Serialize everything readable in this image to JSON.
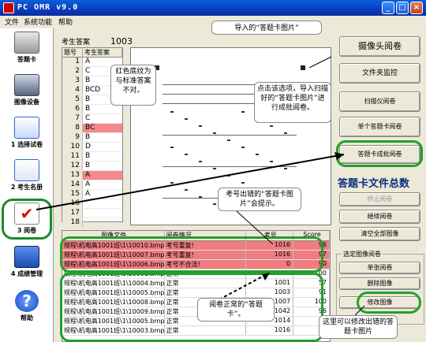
{
  "window": {
    "title": "PC OMR v9.0",
    "min": "_",
    "max": "□",
    "close": "×"
  },
  "menu": [
    "文件",
    "系统功能",
    "帮助"
  ],
  "sidebar": [
    {
      "label": "答题卡",
      "icon": "answer-card-icon"
    },
    {
      "label": "图像设备",
      "icon": "scanner-icon"
    },
    {
      "label": "1 选择试卷",
      "icon": "exam-select-icon"
    },
    {
      "label": "2 考生名册",
      "icon": "roster-icon"
    },
    {
      "label": "3 阅卷",
      "icon": "grading-check-icon"
    },
    {
      "label": "4 成绩管理",
      "icon": "score-management-icon"
    },
    {
      "label": "帮助",
      "icon": "help-icon"
    }
  ],
  "answers": {
    "label": "考生答案",
    "number": "1003",
    "headers": [
      "题号",
      "考生答案"
    ],
    "rows": [
      {
        "n": "1",
        "a": "A",
        "bad": false
      },
      {
        "n": "2",
        "a": "C",
        "bad": false
      },
      {
        "n": "3",
        "a": "B",
        "bad": false
      },
      {
        "n": "4",
        "a": "BCD",
        "bad": false
      },
      {
        "n": "5",
        "a": "B",
        "bad": false
      },
      {
        "n": "6",
        "a": "B",
        "bad": false
      },
      {
        "n": "7",
        "a": "C",
        "bad": false
      },
      {
        "n": "8",
        "a": "BC",
        "bad": true
      },
      {
        "n": "9",
        "a": "B",
        "bad": false
      },
      {
        "n": "10",
        "a": "D",
        "bad": false
      },
      {
        "n": "11",
        "a": "B",
        "bad": false
      },
      {
        "n": "12",
        "a": "B",
        "bad": false
      },
      {
        "n": "13",
        "a": "A",
        "bad": true
      },
      {
        "n": "14",
        "a": "A",
        "bad": false
      },
      {
        "n": "15",
        "a": "A",
        "bad": false
      },
      {
        "n": "16",
        "a": "",
        "bad": false
      },
      {
        "n": "17",
        "a": "",
        "bad": false
      },
      {
        "n": "18",
        "a": "",
        "bad": false
      }
    ]
  },
  "right_panel": {
    "camera": "摄像头阅卷",
    "folder_monitor": "文件夹监控",
    "scanner": "扫描仪阅卷",
    "single_card": "单个答题卡阅卷",
    "batch_card": "答题卡成批阅卷",
    "total_title": "答题卡文件总数",
    "stop": "终止阅卷",
    "continue": "继续阅卷",
    "clear_all": "清空全部图像",
    "group_label": "选定图像阅卷",
    "single_grade": "单张阅卷",
    "delete_image": "删除图像",
    "modify_image": "修改图像"
  },
  "grid": {
    "headers": [
      "图像文件",
      "阅卷情况",
      "考号",
      "Score"
    ],
    "rows": [
      {
        "file": "规程\\机电高1001班\\1\\10010.bmp",
        "status": "考号重复!",
        "id": "1016",
        "score": "96",
        "err": true
      },
      {
        "file": "规程\\机电高1001班\\1\\10007.bmp",
        "status": "考号重复!",
        "id": "1016",
        "score": "97",
        "err": true
      },
      {
        "file": "规程\\机电高1001班\\1\\10006.bmp",
        "status": "考号不合法!",
        "id": "0",
        "score": "90",
        "err": true
      },
      {
        "file": "规程\\机电高1001班\\1\\10001.bmp",
        "status": "正常",
        "id": "1009",
        "score": "100",
        "err": false
      },
      {
        "file": "规程\\机电高1001班\\1\\10004.bmp",
        "status": "正常",
        "id": "1001",
        "score": "57",
        "err": false
      },
      {
        "file": "规程\\机电高1001班\\1\\10005.bmp",
        "status": "正常",
        "id": "1003",
        "score": "91",
        "err": false
      },
      {
        "file": "规程\\机电高1001班\\1\\10008.bmp",
        "status": "正常",
        "id": "1007",
        "score": "100",
        "err": false
      },
      {
        "file": "规程\\机电高1001班\\1\\10009.bmp",
        "status": "正常",
        "id": "1042",
        "score": "96",
        "err": false
      },
      {
        "file": "规程\\机电高1001班\\1\\10005.bmp",
        "status": "正常",
        "id": "1014",
        "score": "94",
        "err": false
      },
      {
        "file": "规程\\机电高1001班\\1\\10003.bmp",
        "status": "正常",
        "id": "1016",
        "score": "93",
        "err": false
      }
    ]
  },
  "callouts": {
    "imported": "导入的“答题卡图片”",
    "red_bg": "红色底纹为与标准答案不对。",
    "batch_tip": "点击该选项，导入扫描好的“答题卡图片”进行成批阅卷。",
    "id_error": "考号出错的“答题卡图片”会提示。",
    "normal": "阅卷正常的“答题卡”。",
    "modify": "这里可以修改出错的答题卡图片"
  },
  "colors": {
    "error_row": "#f07c80",
    "wrong_answer": "#f4888c",
    "highlight_frame": "#22a02c",
    "title_blue": "#0a3bbf"
  }
}
